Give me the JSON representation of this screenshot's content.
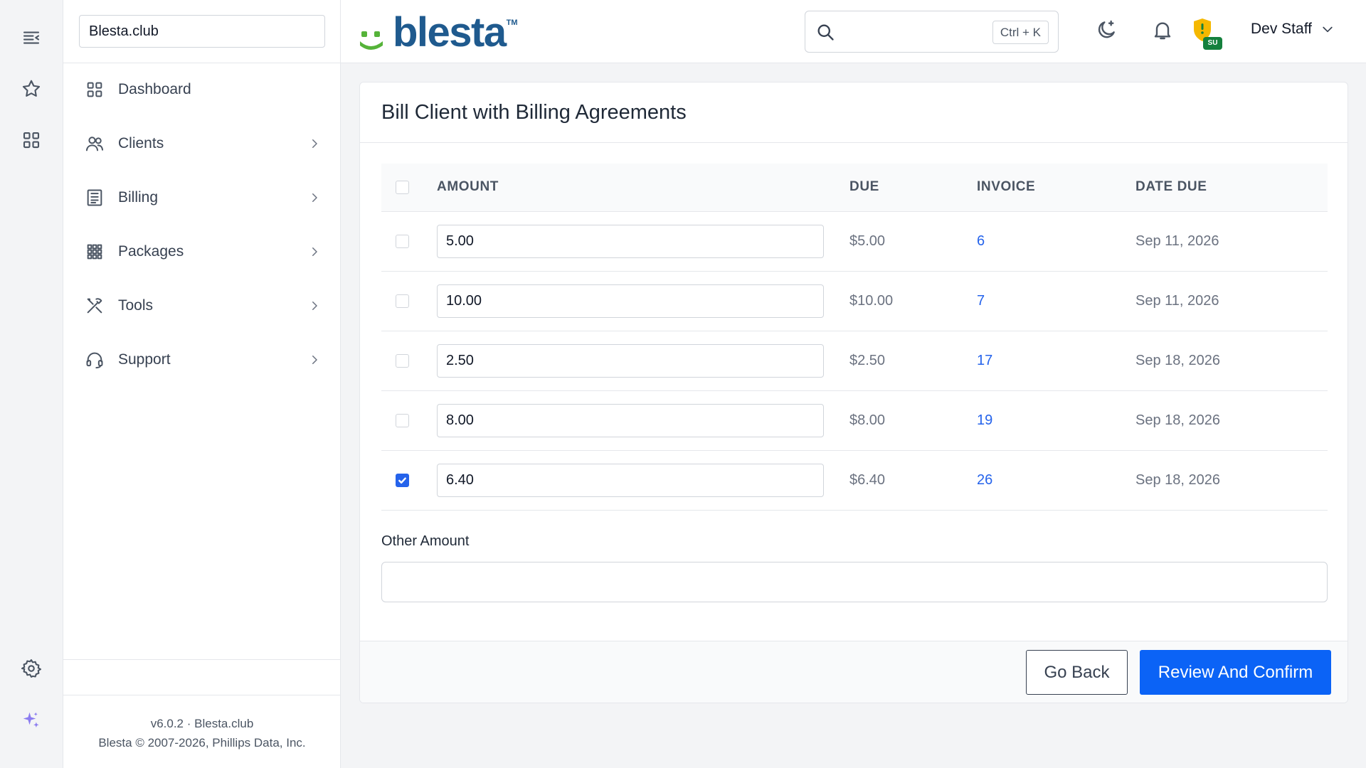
{
  "company": {
    "value": "Blesta.club"
  },
  "header": {
    "logo_text": "blesta",
    "logo_tm": "TM",
    "search": {
      "placeholder": "",
      "shortcut": "Ctrl + K"
    },
    "badge": "SU",
    "user_name": "Dev Staff"
  },
  "sidebar": {
    "items": [
      {
        "label": "Dashboard",
        "icon": "dashboard-icon"
      },
      {
        "label": "Clients",
        "icon": "clients-icon"
      },
      {
        "label": "Billing",
        "icon": "billing-icon"
      },
      {
        "label": "Packages",
        "icon": "packages-icon"
      },
      {
        "label": "Tools",
        "icon": "tools-icon"
      },
      {
        "label": "Support",
        "icon": "support-icon"
      }
    ],
    "footer_line1": "v6.0.2 · Blesta.club",
    "footer_line2": "Blesta © 2007-2026, Phillips Data, Inc."
  },
  "card": {
    "title": "Bill Client with Billing Agreements",
    "columns": {
      "amount": "AMOUNT",
      "due": "DUE",
      "invoice": "INVOICE",
      "date_due": "DATE DUE"
    },
    "rows": [
      {
        "amount": "5.00",
        "due": "$5.00",
        "invoice": "6",
        "date_due": "Sep 11, 2026",
        "checked": false
      },
      {
        "amount": "10.00",
        "due": "$10.00",
        "invoice": "7",
        "date_due": "Sep 11, 2026",
        "checked": false
      },
      {
        "amount": "2.50",
        "due": "$2.50",
        "invoice": "17",
        "date_due": "Sep 18, 2026",
        "checked": false
      },
      {
        "amount": "8.00",
        "due": "$8.00",
        "invoice": "19",
        "date_due": "Sep 18, 2026",
        "checked": false
      },
      {
        "amount": "6.40",
        "due": "$6.40",
        "invoice": "26",
        "date_due": "Sep 18, 2026",
        "checked": true
      }
    ],
    "other_amount_label": "Other Amount",
    "other_amount_value": "",
    "back_label": "Go Back",
    "confirm_label": "Review And Confirm"
  },
  "colors": {
    "accent": "#0b63f6",
    "link": "#2563eb",
    "logo_blue": "#1f5a8e",
    "logo_green": "#55b339",
    "badge_green": "#15803d",
    "shield_yellow": "#f5b800",
    "sparkle_purple": "#8b7cf0"
  }
}
